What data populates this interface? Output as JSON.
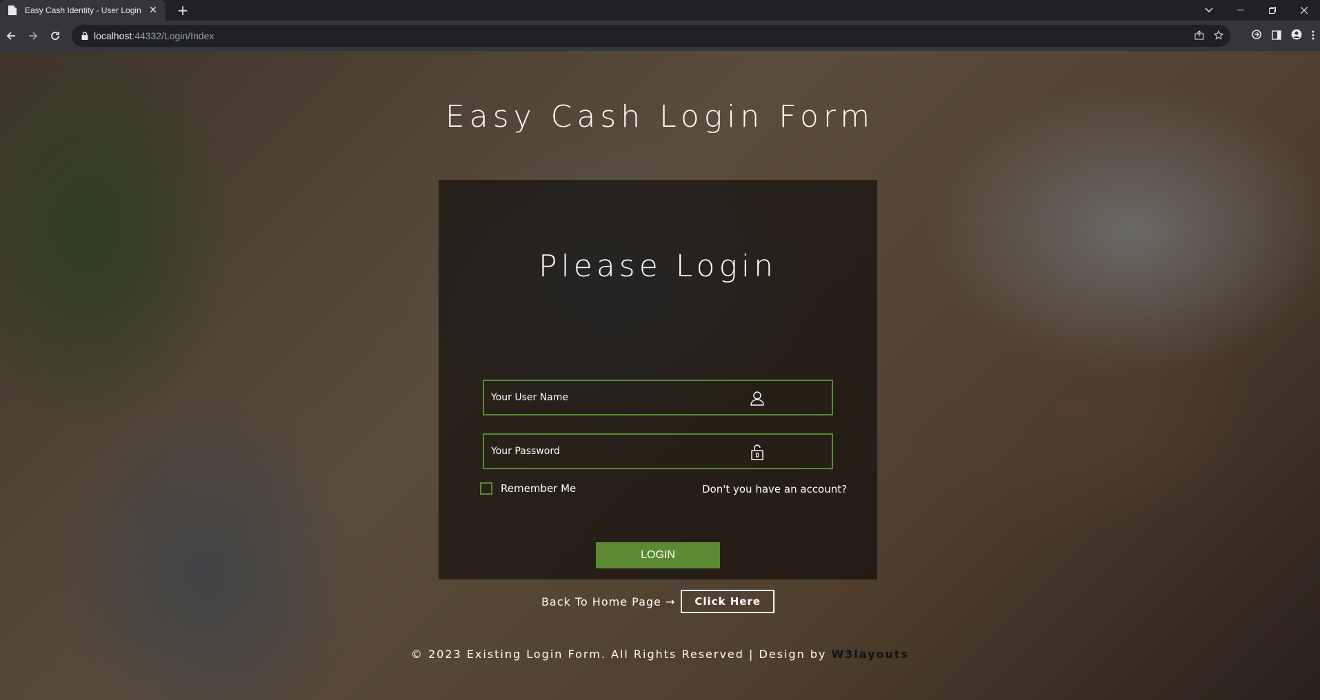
{
  "browser": {
    "tab_title": "Easy Cash Identity - User Login",
    "url_host": "localhost",
    "url_rest": ":44332/Login/Index"
  },
  "page": {
    "title": "Easy Cash Login Form",
    "panel_title": "Please Login",
    "username_placeholder": "Your User Name",
    "password_placeholder": "Your Password",
    "remember_label": "Remember Me",
    "signup_link": "Don't you have an account?",
    "login_button": "LOGIN",
    "back_text": "Back To Home Page →",
    "click_here": "Click Here",
    "footer_text": "© 2023 Existing Login Form. All Rights Reserved | Design by ",
    "footer_brand": "W3layouts"
  },
  "colors": {
    "accent": "#5c8a32"
  }
}
